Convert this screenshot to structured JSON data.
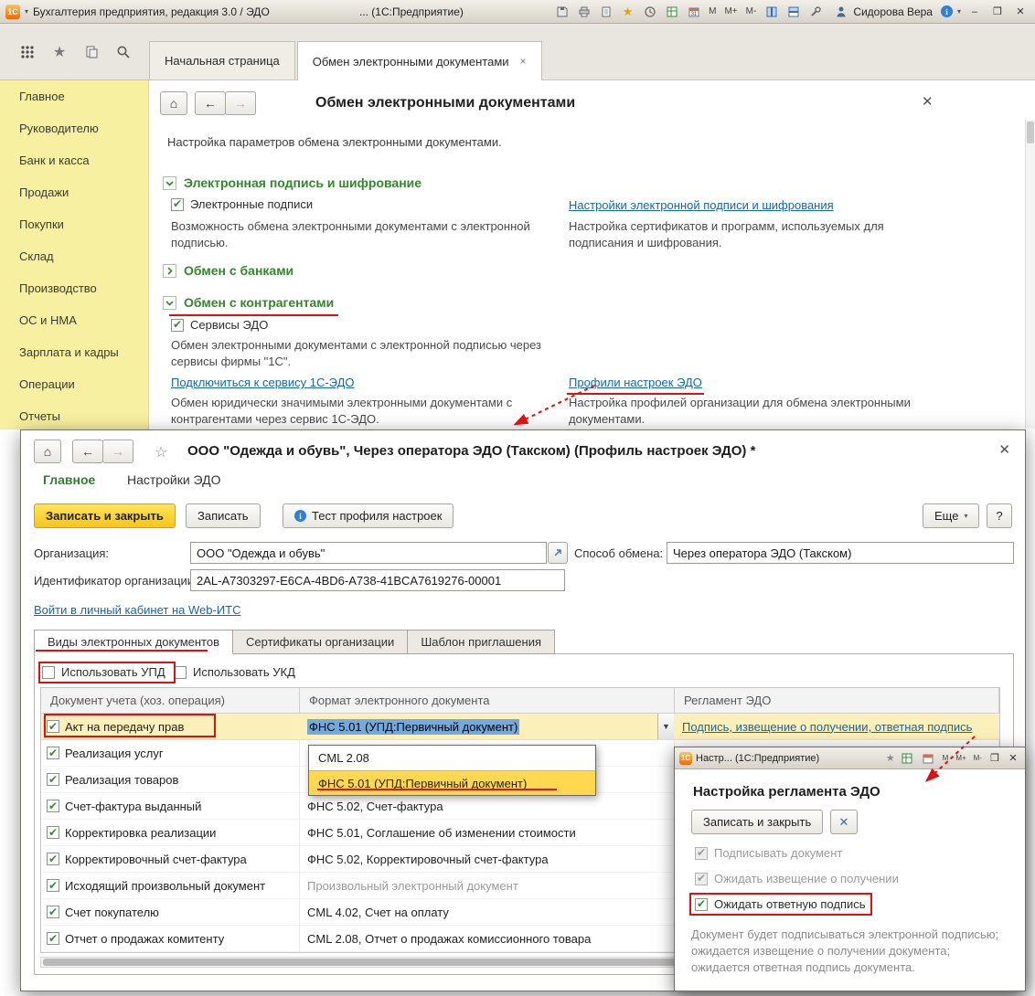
{
  "main": {
    "titlebar": {
      "app_title": "Бухгалтерия предприятия, редакция 3.0 / ЭДО",
      "center_title": "... (1С:Предприятие)",
      "user": "Сидорова Вера",
      "mem": [
        "M",
        "M+",
        "M-"
      ]
    },
    "tabs": {
      "home": "Начальная страница",
      "active": "Обмен электронными документами"
    },
    "sidebar": {
      "items": [
        "Главное",
        "Руководителю",
        "Банк и касса",
        "Продажи",
        "Покупки",
        "Склад",
        "Производство",
        "ОС и НМА",
        "Зарплата и кадры",
        "Операции",
        "Отчеты"
      ]
    },
    "page": {
      "title": "Обмен электронными документами",
      "intro": "Настройка параметров обмена электронными документами.",
      "sec1": {
        "title": "Электронная подпись и шифрование",
        "checkbox": "Электронные подписи",
        "desc": "Возможность обмена электронными документами с электронной подписью.",
        "link": "Настройки электронной подписи и шифрования",
        "link_desc": "Настройка сертификатов и программ, используемых для подписания и шифрования."
      },
      "sec2": {
        "title": "Обмен с банками"
      },
      "sec3": {
        "title": "Обмен с контрагентами",
        "checkbox": "Сервисы ЭДО",
        "desc": "Обмен электронными документами с электронной подписью через сервисы фирмы \"1С\".",
        "link1": "Подключиться к сервису 1С-ЭДО",
        "link1_desc": "Обмен юридически значимыми электронными документами с контрагентами через сервис 1С-ЭДО.",
        "link2": "Профили настроек ЭДО",
        "link2_desc": "Настройка профилей организации для обмена электронными документами."
      }
    }
  },
  "profile": {
    "title": "ООО \"Одежда и обувь\", Через оператора ЭДО (Такском) (Профиль настроек ЭДО) *",
    "menu": [
      "Главное",
      "Настройки ЭДО"
    ],
    "buttons": {
      "save_close": "Записать и закрыть",
      "save": "Записать",
      "test": "Тест профиля настроек",
      "more": "Еще",
      "help": "?"
    },
    "fields": {
      "org_label": "Организация:",
      "org_value": "ООО \"Одежда и обувь\"",
      "method_label": "Способ обмена:",
      "method_value": "Через оператора ЭДО (Такском)",
      "id_label": "Идентификатор организации:",
      "id_value": "2AL-A7303297-E6CA-4BD6-A738-41BCA7619276-00001"
    },
    "link_its": "Войти в личный кабинет на Web-ИТС",
    "tabs": [
      "Виды электронных документов",
      "Сертификаты организации",
      "Шаблон приглашения"
    ],
    "checkboxes": {
      "upd": "Использовать УПД",
      "ukd": "Использовать УКД"
    },
    "table": {
      "headers": [
        "Документ учета (хоз. операция)",
        "Формат электронного документа",
        "Регламент ЭДО"
      ],
      "rows": [
        {
          "label": "Акт на передачу прав",
          "format": "ФНС 5.01 (УПД:Первичный документ)",
          "reglament": "Подпись, извещение о получении, ответная подпись"
        },
        {
          "label": "Реализация услуг",
          "format": "",
          "reglament": ""
        },
        {
          "label": "Реализация товаров",
          "format": "",
          "reglament": ""
        },
        {
          "label": "Счет-фактура выданный",
          "format": "ФНС 5.02, Счет-фактура",
          "reglament": ""
        },
        {
          "label": "Корректировка реализации",
          "format": "ФНС 5.01, Соглашение об изменении стоимости",
          "reglament": ""
        },
        {
          "label": "Корректировочный счет-фактура",
          "format": "ФНС 5.02, Корректировочный счет-фактура",
          "reglament": ""
        },
        {
          "label": "Исходящий произвольный документ",
          "format": "Произвольный электронный документ",
          "reglament": ""
        },
        {
          "label": "Счет покупателю",
          "format": "CML 4.02, Счет на оплату",
          "reglament": ""
        },
        {
          "label": "Отчет о продажах комитенту",
          "format": "CML 2.08, Отчет о продажах комиссионного товара",
          "reglament": ""
        }
      ]
    },
    "dropdown": {
      "items": [
        "CML 2.08",
        "ФНС 5.01 (УПД:Первичный документ)"
      ]
    }
  },
  "reg": {
    "titlebar_title": "Настр...   (1С:Предприятие)",
    "title": "Настройка регламента ЭДО",
    "save_close": "Записать и закрыть",
    "checks": [
      "Подписывать документ",
      "Ожидать извещение о получении",
      "Ожидать ответную подпись"
    ],
    "desc": "Документ будет подписываться электронной подписью; ожидается извещение о получении документа; ожидается ответная подпись документа."
  }
}
